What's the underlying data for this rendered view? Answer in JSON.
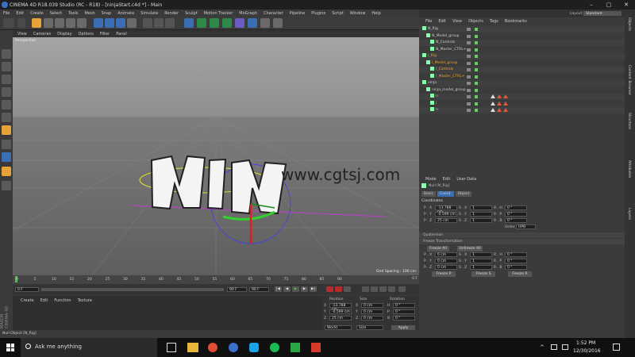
{
  "window": {
    "title": "CINEMA 4D R18.039 Studio (RC - R18) - [ninjaStart.c4d *] - Main",
    "layout_label": "Layout:",
    "layout_value": "Standard"
  },
  "menubar": [
    "File",
    "Edit",
    "Create",
    "Select",
    "Tools",
    "Mesh",
    "Snap",
    "Animate",
    "Simulate",
    "Render",
    "Sculpt",
    "Motion Tracker",
    "MoGraph",
    "Character",
    "Pipeline",
    "Plugins",
    "Script",
    "Window",
    "Help"
  ],
  "viewport": {
    "menu": [
      "View",
      "Cameras",
      "Display",
      "Options",
      "Filter",
      "Panel"
    ],
    "label": "Perspective",
    "grid_spacing": "Grid Spacing : 100 cm",
    "watermark": "www.cgtsj.com"
  },
  "timeline": {
    "ticks": [
      "0",
      "5",
      "10",
      "15",
      "20",
      "25",
      "30",
      "35",
      "40",
      "45",
      "50",
      "55",
      "60",
      "65",
      "70",
      "75",
      "80",
      "85",
      "90"
    ],
    "frame_right": "0 F",
    "start": "0 F",
    "end": "90 F",
    "end2": "90 F"
  },
  "material": {
    "menu": [
      "Create",
      "Edit",
      "Function",
      "Texture"
    ]
  },
  "coords": {
    "headers": [
      "Position",
      "Size",
      "Rotation"
    ],
    "rows": [
      [
        "X",
        "-13.788 cm",
        "X",
        "0 cm",
        "H",
        "0 °"
      ],
      [
        "Y",
        "-0.599 cm",
        "Y",
        "0 cm",
        "P",
        "0 °"
      ],
      [
        "Z",
        "25 cm",
        "Z",
        "0 cm",
        "B",
        "0 °"
      ]
    ],
    "mode": "World",
    "size_mode": "Size",
    "apply": "Apply"
  },
  "statusbar": {
    "text": "Null Object [N_Rig]"
  },
  "objmgr": {
    "menu": [
      "File",
      "Edit",
      "View",
      "Objects",
      "Tags",
      "Bookmarks"
    ],
    "rows": [
      "N_Rig",
      "N_Model_group",
      "N_Controls",
      "N_Master_CTRL+",
      "I_Rig",
      "I_Model_group",
      "I_Controls",
      "I_Master_CTRL+",
      "ninja",
      "ninja_model_group",
      "n",
      "i",
      "n"
    ]
  },
  "attrmgr": {
    "menu": [
      "Mode",
      "Edit",
      "User Data"
    ],
    "object": "Null [N_Rig]",
    "tabs": [
      "Basic",
      "Coord.",
      "Object"
    ],
    "section": "Coordinates",
    "coord_rows": [
      [
        "P . X",
        "-13.788 cm",
        "S . X",
        "1",
        "R . H",
        "0 °"
      ],
      [
        "P . Y",
        "-0.599 cm",
        "S . Y",
        "1",
        "R . P",
        "0 °"
      ],
      [
        "P . Z",
        "25 cm",
        "S . Z",
        "1",
        "R . B",
        "0 °"
      ]
    ],
    "order_label": "Order",
    "order_value": "HPB",
    "quaternion": "Quaternion",
    "freeze_section": "Freeze Transformation",
    "freeze_all": "Freeze All",
    "unfreeze_all": "Unfreeze All",
    "freeze_rows": [
      [
        "P . X",
        "0 cm",
        "S . X",
        "1",
        "R . H",
        "0 °"
      ],
      [
        "P . Y",
        "0 cm",
        "S . Y",
        "1",
        "R . P",
        "0 °"
      ],
      [
        "P . Z",
        "0 cm",
        "S . Z",
        "1",
        "R . B",
        "0 °"
      ]
    ],
    "freeze_p": "Freeze P",
    "freeze_s": "Freeze S",
    "freeze_r": "Freeze R"
  },
  "rightbar": [
    "Objects",
    "Content Browser",
    "Structure",
    "Attributes",
    "Layers"
  ],
  "taskbar": {
    "search": "Ask me anything",
    "time": "1:52 PM",
    "date": "12/30/2016"
  },
  "colors": {
    "accent": "#e8a23a",
    "panel": "#3b3b3b"
  }
}
